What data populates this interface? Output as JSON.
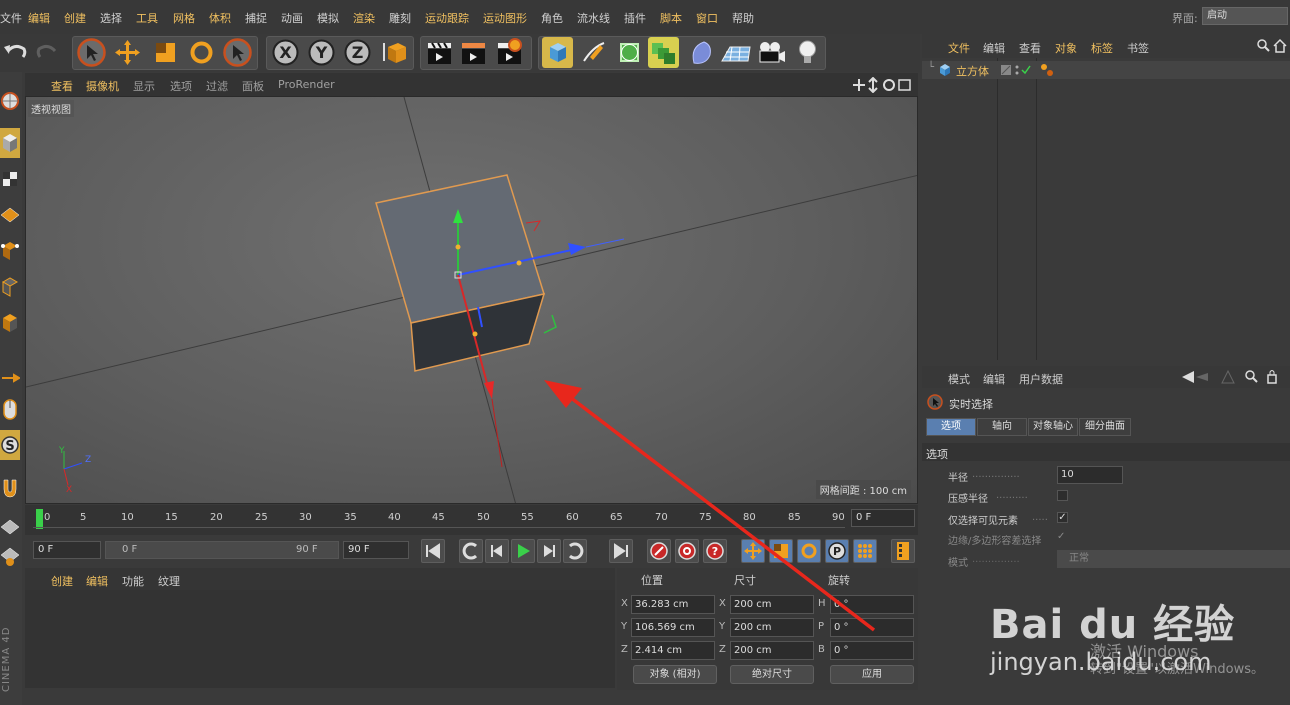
{
  "menubar": {
    "items": [
      "文件",
      "编辑",
      "创建",
      "选择",
      "工具",
      "网格",
      "体积",
      "捕捉",
      "动画",
      "模拟",
      "渲染",
      "雕刻",
      "运动跟踪",
      "运动图形",
      "角色",
      "流水线",
      "插件",
      "脚本",
      "窗口",
      "帮助"
    ],
    "layout_label": "界面:",
    "layout_value": "启动"
  },
  "viewport": {
    "menu": [
      "查看",
      "摄像机",
      "显示",
      "选项",
      "过滤",
      "面板",
      "ProRender"
    ],
    "view_name": "透视视图",
    "grid_spacing": "网格间距 : 100 cm",
    "axis_labels": {
      "y": "Y",
      "z": "Z",
      "x": "X"
    }
  },
  "timeline": {
    "ticks": [
      "0",
      "5",
      "10",
      "15",
      "20",
      "25",
      "30",
      "35",
      "40",
      "45",
      "50",
      "55",
      "60",
      "65",
      "70",
      "75",
      "80",
      "85",
      "90"
    ],
    "current_frame": "0 F"
  },
  "transport": {
    "start": "0 F",
    "range_start": "0 F",
    "range_end": "90 F",
    "end": "90 F"
  },
  "material": {
    "menu": [
      "创建",
      "编辑",
      "功能",
      "纹理"
    ]
  },
  "coords": {
    "headers": {
      "position": "位置",
      "size": "尺寸",
      "rotation": "旋转"
    },
    "rows": [
      {
        "axis": "X",
        "pos": "36.283 cm",
        "size_axis": "X",
        "size": "200 cm",
        "rot_axis": "H",
        "rot": "0 °"
      },
      {
        "axis": "Y",
        "pos": "106.569 cm",
        "size_axis": "Y",
        "size": "200 cm",
        "rot_axis": "P",
        "rot": "0 °"
      },
      {
        "axis": "Z",
        "pos": "2.414 cm",
        "size_axis": "Z",
        "size": "200 cm",
        "rot_axis": "B",
        "rot": "0 °"
      }
    ],
    "mode": "对象 (相对)",
    "size_mode": "绝对尺寸",
    "apply": "应用"
  },
  "object_manager": {
    "menu": [
      "文件",
      "编辑",
      "查看",
      "对象",
      "标签",
      "书签"
    ],
    "objects": [
      {
        "name": "立方体"
      }
    ]
  },
  "attributes": {
    "menu": [
      "模式",
      "编辑",
      "用户数据"
    ],
    "tool_name": "实时选择",
    "tabs": [
      "选项",
      "轴向",
      "对象轴心",
      "细分曲面"
    ],
    "section": "选项",
    "fields": {
      "radius_label": "半径",
      "radius_value": "10",
      "pressure_label": "压感半径",
      "visible_only_label": "仅选择可见元素",
      "tolerance_label": "边缘/多边形容差选择",
      "mode_label": "模式",
      "mode_value": "正常"
    }
  },
  "app_brand": "CINEMA 4D",
  "watermark": {
    "logo": "Bai du 经验",
    "url": "jingyan.baidu.com",
    "windows_line1": "激活 Windows",
    "windows_line2": "转到\"设置\"以激活Windows。"
  },
  "colors": {
    "accent_orange": "#f0c060",
    "selection_blue": "#5a7fb0",
    "annotation_red": "#e8271c"
  }
}
